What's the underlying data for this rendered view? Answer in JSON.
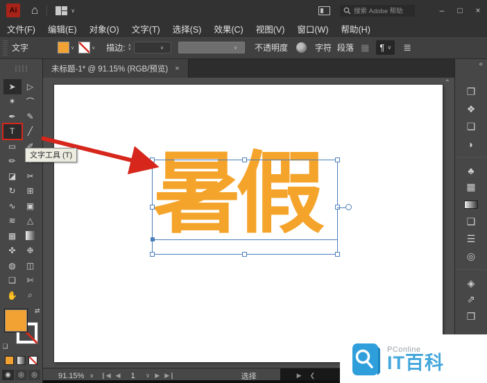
{
  "titlebar": {
    "app_logo": "Ai",
    "home_icon": "⌂",
    "layout_chevron": "∨",
    "search_placeholder": "搜索 Adobe 帮助",
    "minimize": "–",
    "maximize": "□",
    "close": "×"
  },
  "menubar": {
    "items": [
      "文件(F)",
      "编辑(E)",
      "对象(O)",
      "文字(T)",
      "选择(S)",
      "效果(C)",
      "视图(V)",
      "窗口(W)",
      "帮助(H)"
    ]
  },
  "controlbar": {
    "context_label": "文字",
    "fill_chevron": "∨",
    "stroke_chevron": "∨",
    "stroke_label": "描边:",
    "stepper_up": "∧",
    "stepper_down": "∨",
    "dd_chevron": "∨",
    "opacity_label": "不透明度",
    "character_label": "字符",
    "paragraph_label": "段落",
    "align_dim_glyph": "▦",
    "pbtn_glyph": "¶",
    "pbtn_chevron": "∨",
    "panel_menu_glyph": "≣"
  },
  "tab": {
    "title": "未标题-1* @ 91.15% (RGB/预览)",
    "close": "×",
    "collapse_chevron": "«"
  },
  "toolbar": {
    "tools": [
      {
        "name": "selection-tool",
        "glyph": "➤",
        "cls": "active"
      },
      {
        "name": "direct-selection-tool",
        "glyph": "▷"
      },
      {
        "name": "magic-wand-tool",
        "glyph": "✶"
      },
      {
        "name": "lasso-tool",
        "glyph": "⌒"
      },
      {
        "name": "pen-tool",
        "glyph": "✒"
      },
      {
        "name": "curvature-tool",
        "glyph": "✎"
      },
      {
        "name": "type-tool",
        "glyph": "T",
        "cls": "boxed"
      },
      {
        "name": "line-segment-tool",
        "glyph": "╱"
      },
      {
        "name": "rectangle-tool",
        "glyph": "▭"
      },
      {
        "name": "paintbrush-tool",
        "glyph": "✐"
      },
      {
        "name": "pencil-tool",
        "glyph": "✏"
      },
      {
        "name": "shaper-tool",
        "glyph": "✧"
      },
      {
        "name": "eraser-tool",
        "glyph": "◪"
      },
      {
        "name": "scissors-tool",
        "glyph": "✂"
      },
      {
        "name": "rotate-tool",
        "glyph": "↻"
      },
      {
        "name": "free-transform-tool",
        "glyph": "⊞"
      },
      {
        "name": "width-tool",
        "glyph": "∿"
      },
      {
        "name": "shape-builder-tool",
        "glyph": "▣"
      },
      {
        "name": "warp-tool",
        "glyph": "≋"
      },
      {
        "name": "perspective-grid-tool",
        "glyph": "△"
      },
      {
        "name": "mesh-tool",
        "glyph": "▦"
      },
      {
        "name": "gradient-tool",
        "glyph": "",
        "cls": "gradient-chip"
      },
      {
        "name": "eyedropper-tool",
        "glyph": "✜"
      },
      {
        "name": "symbol-sprayer-tool",
        "glyph": "❉"
      },
      {
        "name": "blend-tool",
        "glyph": "◍"
      },
      {
        "name": "column-graph-tool",
        "glyph": "◫"
      },
      {
        "name": "artboard-tool",
        "glyph": "❏"
      },
      {
        "name": "slice-tool",
        "glyph": "✄"
      },
      {
        "name": "hand-tool",
        "glyph": "✋"
      },
      {
        "name": "zoom-tool",
        "glyph": "⌕"
      }
    ],
    "swap_glyph": "⇄",
    "default_colors_glyph": "❏"
  },
  "canvas": {
    "text": "暑假",
    "tooltip": "文字工具 (T)",
    "scroll_chevron": "⌃"
  },
  "right_panel": {
    "icons": [
      {
        "name": "libraries-icon",
        "glyph": "❐"
      },
      {
        "name": "color-icon",
        "glyph": "❖"
      },
      {
        "name": "color-guide-icon",
        "glyph": "❏"
      },
      {
        "name": "appearance-icon",
        "glyph": "◗"
      },
      {
        "name": "symbols-icon",
        "glyph": "♣",
        "cls": "sep"
      },
      {
        "name": "swatches-icon",
        "glyph": "▦"
      },
      {
        "name": "gradient-icon",
        "glyph": "",
        "cls": "gradient-chip-wide"
      },
      {
        "name": "pathfinder-icon",
        "glyph": "❑"
      },
      {
        "name": "stroke-icon",
        "glyph": "☰"
      },
      {
        "name": "transparency-icon",
        "glyph": "◎"
      },
      {
        "name": "layers-icon",
        "glyph": "◈",
        "cls": "sep"
      },
      {
        "name": "export-icon",
        "glyph": "⇗"
      },
      {
        "name": "artboards-icon",
        "glyph": "❒"
      }
    ]
  },
  "statusbar": {
    "zoom": "91.15%",
    "zoom_chevron": "∨",
    "nav_first": "❙◀",
    "nav_prev": "◀",
    "artboard": "1",
    "nav_chevron": "∨",
    "nav_next": "▶",
    "nav_last": "▶❙",
    "mode": "选择",
    "play_glyph": "▶",
    "back_glyph": "❮"
  },
  "watermark": {
    "brand": "PConline",
    "title": "IT百科"
  },
  "colors": {
    "accent_orange": "#f2a232",
    "text_orange": "#f5a42b",
    "selection_blue": "#4a7ebb",
    "annotation_red": "#d7261c",
    "watermark_blue": "#45a7dc"
  }
}
